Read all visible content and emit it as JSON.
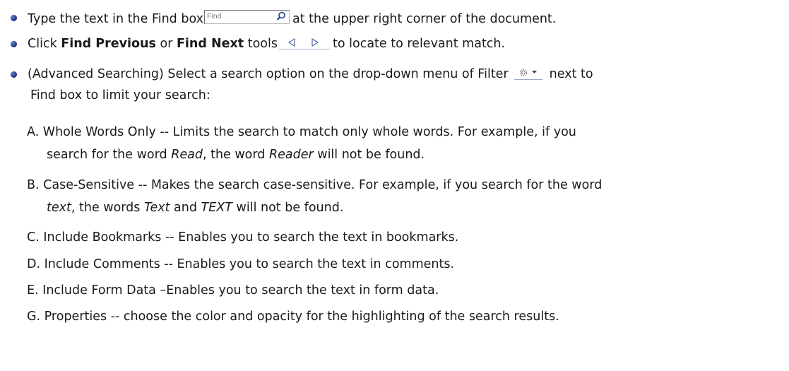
{
  "bullets": {
    "b1": {
      "part1": "Type the text in the Find box",
      "part2": "at the upper right corner of the document."
    },
    "b2": {
      "part1": "Click ",
      "bold1": "Find Previous",
      "part2": " or ",
      "bold2": "Find Next",
      "part3": " tools",
      "part4": "to locate to relevant match."
    },
    "b3": {
      "line1a": "(Advanced Searching) Select a search option on the drop-down menu of Filter",
      "line1b": "next to",
      "line2": "Find box to limit your search:"
    }
  },
  "find_box": {
    "placeholder": "Find"
  },
  "items": {
    "a": {
      "l1a": "A.  Whole Words Only -- Limits the search to match only whole words. For example, if you",
      "l2a": "search for the word ",
      "l2b": "Read",
      "l2c": ", the word ",
      "l2d": "Reader",
      "l2e": " will not be found."
    },
    "b": {
      "l1a": "B.  Case-Sensitive -- Makes the search case-sensitive. For example, if you search for the word",
      "l2a": "text",
      "l2b": ", the words ",
      "l2c": "Text",
      "l2d": " and ",
      "l2e": "TEXT",
      "l2f": " will not be found."
    },
    "c": "C.  Include Bookmarks -- Enables you to search the text in bookmarks.",
    "d": "D.  Include Comments -- Enables you to search the text in comments.",
    "e": "E.  Include Form Data –Enables you to search the text in form data.",
    "g": "G.   Properties -- choose the color and opacity for the highlighting of the search results."
  },
  "icons": {
    "find_box_icon": "magnifier-icon",
    "previous": "triangle-left-icon",
    "next": "triangle-right-icon",
    "filter": "gear-dropdown-icon"
  },
  "colors": {
    "bullet": "#1f3a93",
    "text": "#1a1a1a"
  }
}
